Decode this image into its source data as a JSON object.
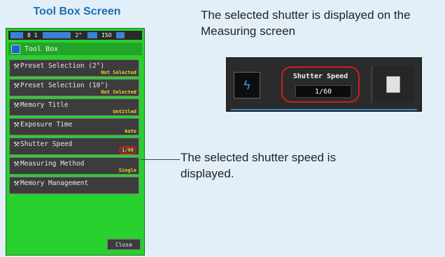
{
  "heading": "Tool Box Screen",
  "device": {
    "status_bar": {
      "left": "8 1",
      "center": "2\"",
      "right": "ISO"
    },
    "title": "Tool Box",
    "menu": [
      {
        "label": "Preset Selection (2°)",
        "value": "Not Selected"
      },
      {
        "label": "Preset Selection (10°)",
        "value": "Not Selected"
      },
      {
        "label": "Memory Title",
        "value": "Untitled"
      },
      {
        "label": "Exposure Time",
        "value": "Auto"
      },
      {
        "label": "Shutter Speed",
        "value": "1/60"
      },
      {
        "label": "Measuring Method",
        "value": "Single"
      },
      {
        "label": "Memory Management",
        "value": ""
      }
    ],
    "close_label": "Close"
  },
  "annotations": {
    "top": "The selected shutter is displayed on the Measuring screen",
    "callout": "The selected shutter speed is displayed."
  },
  "measuring_screen": {
    "title": "Shutter Speed",
    "value": "1/60",
    "left_icon": "flash-icon",
    "right_icon": "memory-card-icon"
  },
  "colors": {
    "device_green": "#28d12e",
    "heading_blue": "#1b6fb3",
    "highlight_red": "#cc1f1f",
    "value_yellow": "#e8d52a"
  }
}
